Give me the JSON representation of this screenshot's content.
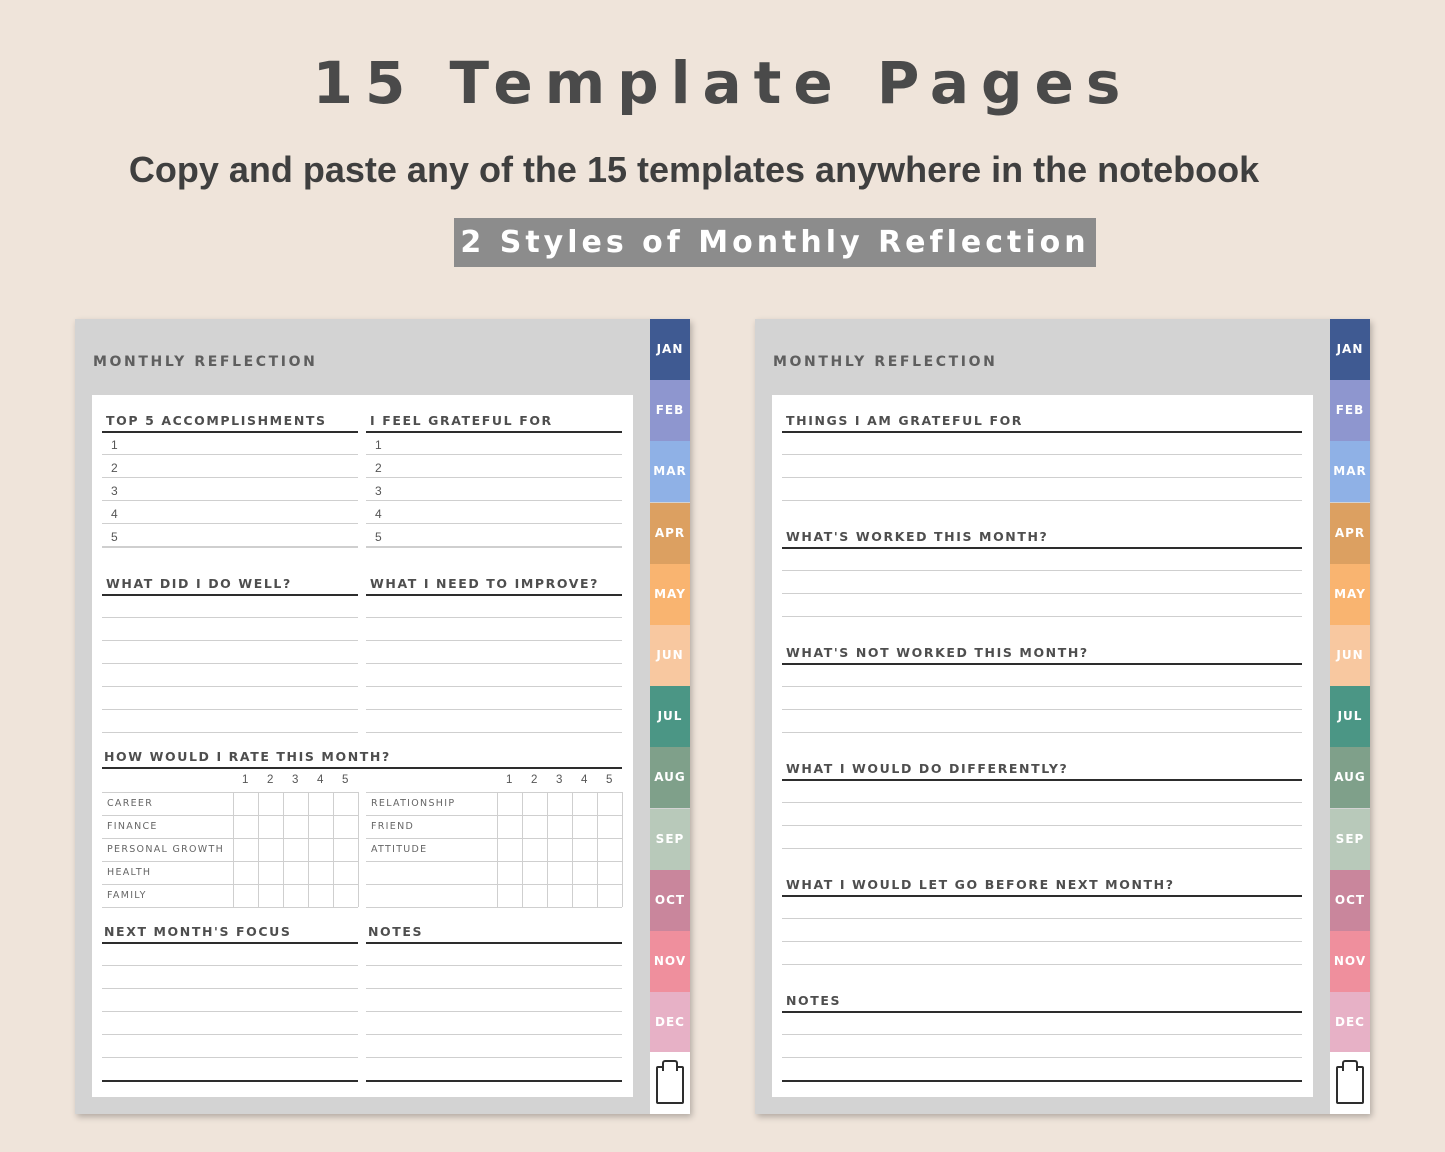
{
  "header": {
    "title": "15 Template Pages",
    "subtitle": "Copy and paste any of the 15 templates anywhere in the notebook",
    "banner": "2 Styles of Monthly Reflection"
  },
  "months": [
    {
      "label": "JAN",
      "color": "#3f5a92"
    },
    {
      "label": "FEB",
      "color": "#8e96cf"
    },
    {
      "label": "MAR",
      "color": "#8fb1e6"
    },
    {
      "label": "APR",
      "color": "#dca061"
    },
    {
      "label": "MAY",
      "color": "#f9b470"
    },
    {
      "label": "JUN",
      "color": "#f8c8a0"
    },
    {
      "label": "JUL",
      "color": "#4b9685"
    },
    {
      "label": "AUG",
      "color": "#7fa08a"
    },
    {
      "label": "SEP",
      "color": "#b8c9ba"
    },
    {
      "label": "OCT",
      "color": "#c9869c"
    },
    {
      "label": "NOV",
      "color": "#ef8f9d"
    },
    {
      "label": "DEC",
      "color": "#e7b1c6"
    }
  ],
  "page1": {
    "heading": "MONTHLY REFLECTION",
    "accomplishments": "TOP 5 ACCOMPLISHMENTS",
    "grateful": "I FEEL GRATEFUL FOR",
    "numbers": [
      "1",
      "2",
      "3",
      "4",
      "5"
    ],
    "did_well": "WHAT DID I DO WELL?",
    "improve": "WHAT I NEED TO IMPROVE?",
    "rate": "HOW WOULD I RATE THIS MONTH?",
    "scale": [
      "1",
      "2",
      "3",
      "4",
      "5"
    ],
    "rate_left": [
      "CAREER",
      "FINANCE",
      "PERSONAL GROWTH",
      "HEALTH",
      "FAMILY"
    ],
    "rate_right": [
      "RELATIONSHIP",
      "FRIEND",
      "ATTITUDE",
      "",
      ""
    ],
    "focus": "NEXT MONTH'S FOCUS",
    "notes": "NOTES"
  },
  "page2": {
    "heading": "MONTHLY REFLECTION",
    "sections": [
      "THINGS I AM GRATEFUL FOR",
      "WHAT'S WORKED THIS MONTH?",
      "WHAT'S NOT WORKED THIS MONTH?",
      "WHAT I WOULD DO DIFFERENTLY?",
      "WHAT I WOULD LET GO BEFORE NEXT MONTH?",
      "NOTES"
    ]
  }
}
